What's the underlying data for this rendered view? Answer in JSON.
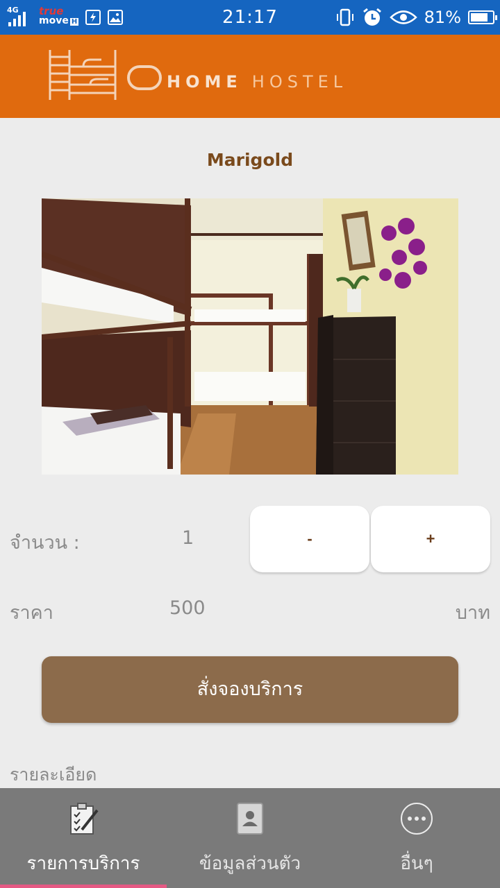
{
  "status_bar": {
    "network": "4G",
    "carrier_line1": "true",
    "carrier_line2": "move",
    "carrier_badge": "H",
    "time": "21:17",
    "battery_pct": "81%",
    "battery_level": 0.81,
    "icons": [
      "signal-icon",
      "sim-icon",
      "image-icon",
      "vibrate-icon",
      "alarm-icon",
      "eye-icon",
      "battery-icon"
    ]
  },
  "header": {
    "logo_bold": "HOME",
    "logo_light": "HOSTEL"
  },
  "room": {
    "title": "Marigold",
    "photo_alt": "bunk-bed-room-photo"
  },
  "quantity": {
    "label": "จำนวน :",
    "value": "1",
    "minus_label": "-",
    "plus_label": "+"
  },
  "price": {
    "label": "ราคา",
    "value": "500",
    "unit": "บาท"
  },
  "booking": {
    "button_label": "สั่งจองบริการ"
  },
  "details": {
    "label": "รายละเอียด"
  },
  "tabs": [
    {
      "label": "รายการบริการ",
      "icon": "checklist-icon",
      "active": true
    },
    {
      "label": "ข้อมูลส่วนตัว",
      "icon": "contact-book-icon",
      "active": false
    },
    {
      "label": "อื่นๆ",
      "icon": "more-icon",
      "active": false
    }
  ],
  "colors": {
    "status_bar": "#1565c0",
    "header": "#e06a0e",
    "title": "#7a4a1c",
    "book_button": "#8c6b4b",
    "tab_bar": "#7a7a7a",
    "tab_indicator": "#e55a84"
  }
}
